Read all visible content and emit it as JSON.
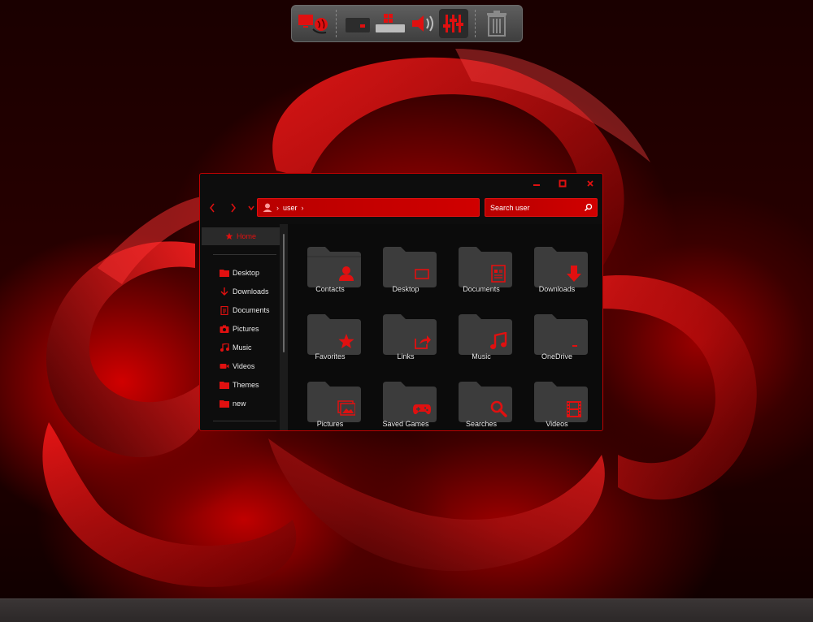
{
  "window": {
    "address": {
      "segment": "user"
    },
    "search": {
      "placeholder": "Search user"
    }
  },
  "sidebar": {
    "home": "Home",
    "items": [
      {
        "label": "Desktop",
        "icon": "folder-icon"
      },
      {
        "label": "Downloads",
        "icon": "download-arrow-icon"
      },
      {
        "label": "Documents",
        "icon": "document-icon"
      },
      {
        "label": "Pictures",
        "icon": "camera-icon"
      },
      {
        "label": "Music",
        "icon": "music-note-icon"
      },
      {
        "label": "Videos",
        "icon": "video-camera-icon"
      },
      {
        "label": "Themes",
        "icon": "folder-icon"
      },
      {
        "label": "new",
        "icon": "folder-icon"
      }
    ]
  },
  "folders": [
    {
      "label": "Contacts",
      "icon": "person-icon"
    },
    {
      "label": "Desktop",
      "icon": "monitor-icon"
    },
    {
      "label": "Documents",
      "icon": "document-icon"
    },
    {
      "label": "Downloads",
      "icon": "download-arrow-icon"
    },
    {
      "label": "Favorites",
      "icon": "star-icon"
    },
    {
      "label": "Links",
      "icon": "share-arrow-icon"
    },
    {
      "label": "Music",
      "icon": "music-note-icon"
    },
    {
      "label": "OneDrive",
      "icon": "cloud-icon"
    },
    {
      "label": "Pictures",
      "icon": "picture-icon"
    },
    {
      "label": "Saved Games",
      "icon": "gamepad-icon"
    },
    {
      "label": "Searches",
      "icon": "magnifier-icon"
    },
    {
      "label": "Videos",
      "icon": "film-icon"
    }
  ],
  "colors": {
    "accent": "#e01010",
    "folder": "#3c3c3c",
    "window_bg": "#0d0d0d"
  }
}
